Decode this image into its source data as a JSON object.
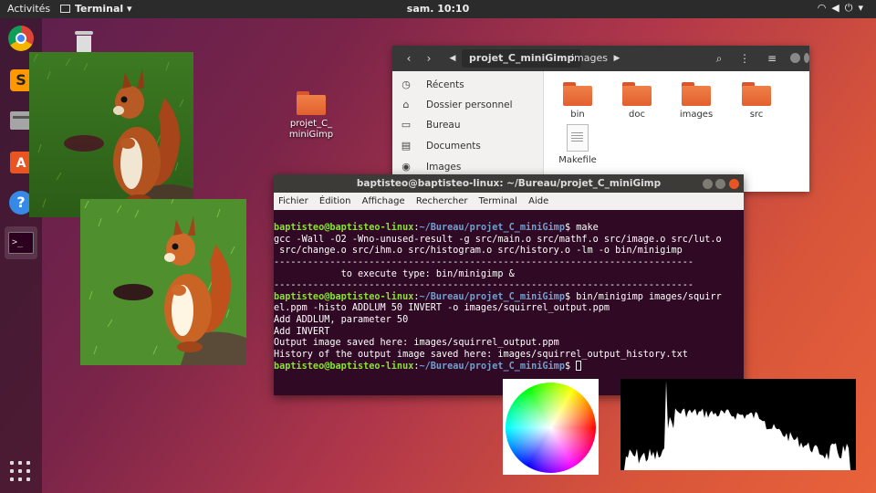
{
  "topbar": {
    "activities": "Activités",
    "app_name": "Terminal",
    "clock": "sam. 10:10",
    "tray_icons": [
      "wifi-icon",
      "volume-icon",
      "power-icon"
    ]
  },
  "dock": {
    "items": [
      "chrome-icon",
      "sublime-text-icon",
      "files-icon",
      "software-store-icon",
      "help-icon",
      "terminal-icon"
    ],
    "active": "terminal-icon",
    "show_apps": "app-grid-icon"
  },
  "desktop": {
    "trash_icon": "trash-icon",
    "folder_label": "projet_C_\nminiGimp",
    "folder_color": "#e8692f"
  },
  "filemanager": {
    "path": [
      "projet_C_miniGimp",
      "images"
    ],
    "sidebar": [
      {
        "icon": "clock-icon",
        "label": "Récents"
      },
      {
        "icon": "home-icon",
        "label": "Dossier personnel"
      },
      {
        "icon": "desktop-icon",
        "label": "Bureau"
      },
      {
        "icon": "documents-icon",
        "label": "Documents"
      },
      {
        "icon": "camera-icon",
        "label": "Images"
      }
    ],
    "items": [
      {
        "type": "folder",
        "name": "bin"
      },
      {
        "type": "folder",
        "name": "doc"
      },
      {
        "type": "folder",
        "name": "images"
      },
      {
        "type": "folder",
        "name": "src"
      },
      {
        "type": "file",
        "name": "Makefile"
      }
    ]
  },
  "terminal": {
    "title": "baptisteo@baptisteo-linux: ~/Bureau/projet_C_miniGimp",
    "menu": [
      "Fichier",
      "Édition",
      "Affichage",
      "Rechercher",
      "Terminal",
      "Aide"
    ],
    "prompt_user": "baptisteo@baptisteo-linux",
    "prompt_path": "~/Bureau/projet_C_miniGimp",
    "cmd1": "make",
    "out1a": "gcc -Wall -O2 -Wno-unused-result -g src/main.o src/mathf.o src/image.o src/lut.o",
    "out1b": " src/change.o src/ihm.o src/histogram.o src/history.o -lm -o bin/minigimp",
    "sep": "---------------------------------------------------------------------------",
    "out1c": "            to execute type: bin/minigimp &",
    "cmd2": "bin/minigimp images/squirr",
    "cmd2b": "el.ppm -histo ADDLUM 50 INVERT -o images/squirrel_output.ppm",
    "out2a": "Add ADDLUM, parameter 50",
    "out2b": "Add INVERT",
    "out2c": "Output image saved here: images/squirrel_output.ppm",
    "out2d": "History of the output image saved here: images/squirrel_output_history.txt"
  },
  "colors": {
    "ubuntu_orange": "#e95420",
    "terminal_bg": "#300a24",
    "prompt_user": "#8ae234",
    "prompt_path": "#729fcf"
  }
}
